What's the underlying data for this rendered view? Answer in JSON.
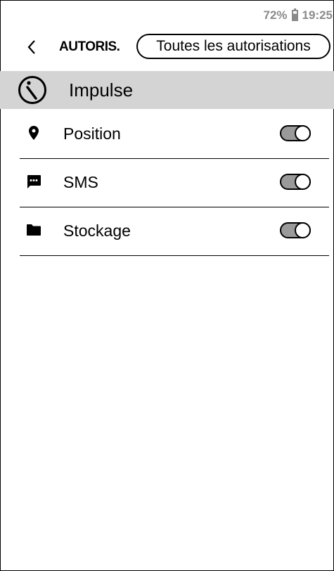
{
  "status_bar": {
    "battery": "72%",
    "time": "19:25"
  },
  "toolbar": {
    "title": "AUTORIS.",
    "filter_label": "Toutes les autorisations",
    "back_icon": "chevron-left-icon"
  },
  "app": {
    "name": "Impulse",
    "icon": "info-icon"
  },
  "permissions": [
    {
      "label": "Position",
      "icon": "location-pin-icon",
      "enabled": false
    },
    {
      "label": "SMS",
      "icon": "message-icon",
      "enabled": false
    },
    {
      "label": "Stockage",
      "icon": "folder-icon",
      "enabled": false
    }
  ],
  "colors": {
    "header_bg": "#d4d4d4",
    "status_text": "#8a8a8a",
    "toggle_track": "#9a9a9a"
  }
}
